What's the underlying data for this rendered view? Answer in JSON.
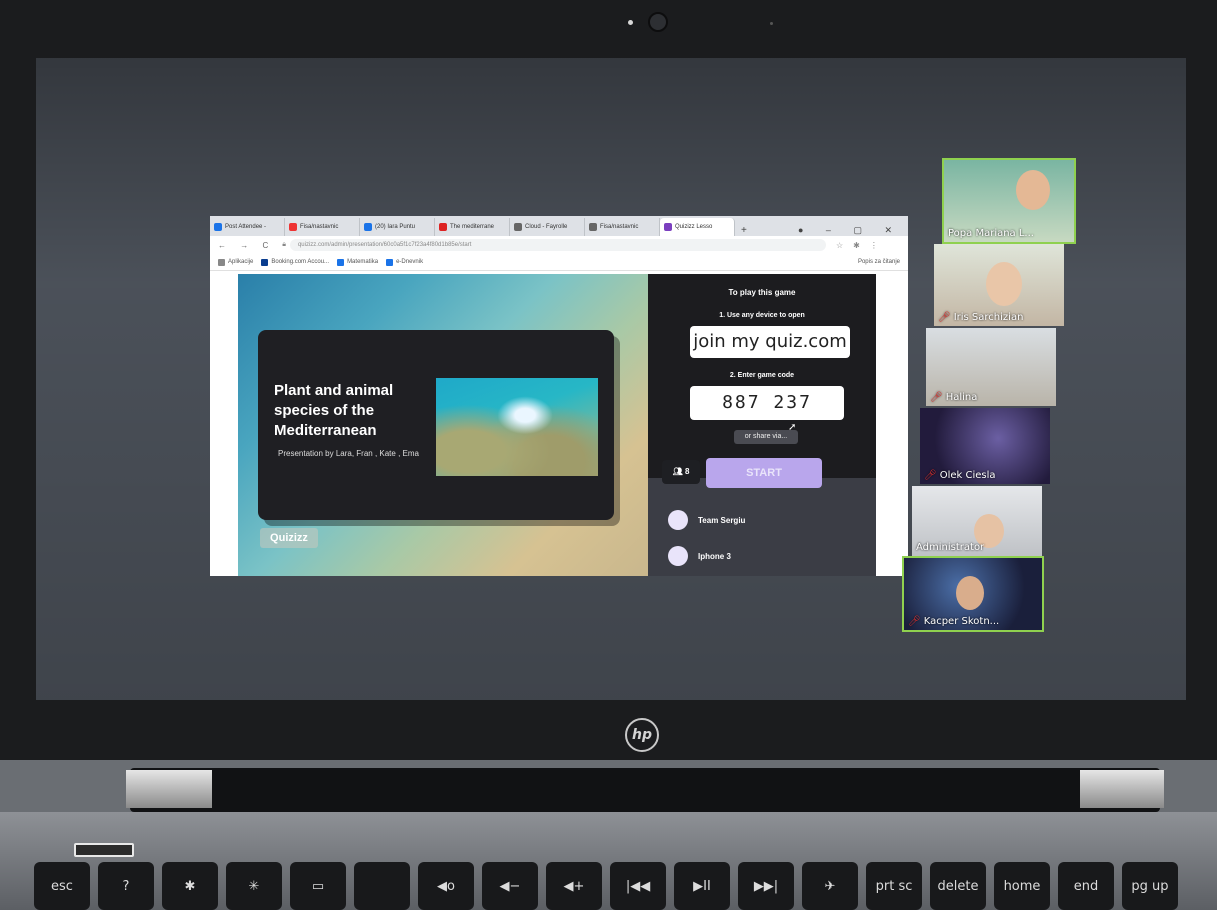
{
  "browser": {
    "tabs": [
      {
        "label": "Post Attendee -"
      },
      {
        "label": "Fisa/nastavnic"
      },
      {
        "label": "(20) Iara Puntu"
      },
      {
        "label": "The mediterrane"
      },
      {
        "label": "Cloud - Fayrolle"
      },
      {
        "label": "Fisa/nastavnic"
      },
      {
        "label": "Quizizz Lesso"
      }
    ],
    "url": "quizizz.com/admin/presentation/60c0a5f1c7f23a4f80d1b85e/start",
    "bookmarks": [
      "Aplikacije",
      "Booking.com Accou...",
      "Matematika",
      "e-Dnevnik"
    ],
    "bookmarks_right": "Popis za čitanje"
  },
  "quiz": {
    "title": "Plant and animal species of the Mediterranean",
    "subtitle": "Presentation by Lara, Fran , Kate , Ema",
    "logo": "Quizizz",
    "play_heading": "To play this game",
    "step1": "1. Use any device to open",
    "join_url": "join my quiz.com",
    "step2": "2. Enter game code",
    "game_code": "887 237",
    "share_label": "or share via...",
    "player_count": "8",
    "start_label": "START",
    "players": [
      {
        "name": "Team Sergiu"
      },
      {
        "name": "Iphone 3"
      }
    ]
  },
  "participants": [
    {
      "name": "Popa Mariana L..."
    },
    {
      "name": "Iris Sarchizian"
    },
    {
      "name": "Halina"
    },
    {
      "name": "Olek Ciesla"
    },
    {
      "name": "Administrator"
    },
    {
      "name": "Kacper Skotn..."
    }
  ],
  "keyboard": [
    "esc",
    "?",
    "✱",
    "✳",
    "▭",
    "",
    "◀o",
    "◀−",
    "◀+",
    "|◀◀",
    "▶II",
    "▶▶|",
    "✈",
    "prt sc",
    "delete",
    "home",
    "end",
    "pg up"
  ],
  "brand": "hp"
}
